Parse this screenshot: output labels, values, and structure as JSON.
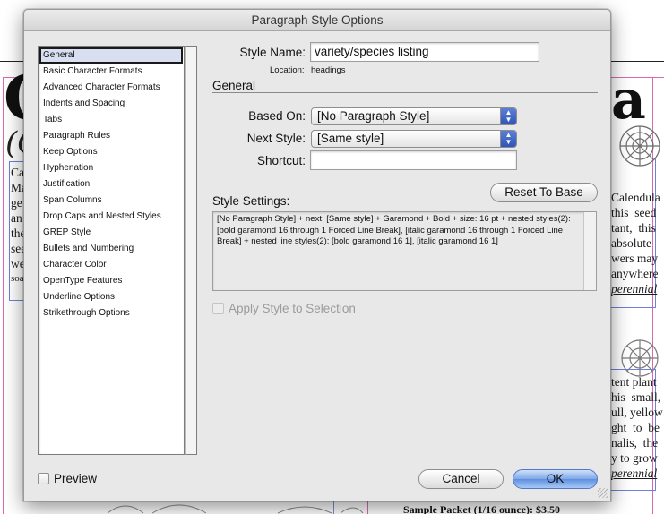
{
  "dialog": {
    "title": "Paragraph Style Options",
    "style_name_label": "Style Name:",
    "style_name_value": "variety/species listing",
    "location_label": "Location:",
    "location_value": "headings",
    "section_title": "General",
    "based_on_label": "Based On:",
    "based_on_value": "[No Paragraph Style]",
    "next_style_label": "Next Style:",
    "next_style_value": "[Same style]",
    "shortcut_label": "Shortcut:",
    "shortcut_value": "",
    "reset_button": "Reset To Base",
    "style_settings_label": "Style Settings:",
    "style_settings_text": "[No Paragraph Style] + next: [Same style] + Garamond + Bold + size: 16 pt + nested styles(2): [bold garamond 16 through 1 Forced Line Break], [italic garamond 16 through 1 Forced Line Break] + nested line styles(2): [bold garamond 16 1], [italic garamond 16 1]",
    "apply_label": "Apply Style to Selection",
    "preview_label": "Preview",
    "cancel_button": "Cancel",
    "ok_button": "OK",
    "categories": [
      "General",
      "Basic Character Formats",
      "Advanced Character Formats",
      "Indents and Spacing",
      "Tabs",
      "Paragraph Rules",
      "Keep Options",
      "Hyphenation",
      "Justification",
      "Span Columns",
      "Drop Caps and Nested Styles",
      "GREP Style",
      "Bullets and Numbering",
      "Character Color",
      "OpenType Features",
      "Underline Options",
      "Strikethrough Options"
    ],
    "selected_category": "General"
  },
  "document": {
    "big_c": "C",
    "big_a": "a",
    "paren": "(C",
    "left_fragments": [
      "Ca",
      "Ma",
      "ge",
      "an",
      "the",
      "see",
      "we",
      "soa"
    ],
    "right_block_1": [
      "Calendula",
      "this  seed",
      "tant,  this",
      "absolute",
      "wers may",
      "anywhere",
      "perennial"
    ],
    "right_block_2": [
      "tent plant",
      "his  small,",
      "ull, yellow",
      "ght  to  be",
      "nalis,  the",
      "y to grow",
      "perennial"
    ],
    "sample_line": "Sample Packet (1/16 ounce): $3.50"
  },
  "icons": {
    "popup_arrows": "updown-arrows-icon"
  }
}
